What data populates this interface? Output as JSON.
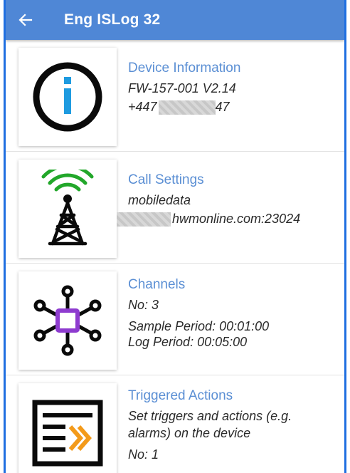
{
  "appbar": {
    "title": "Eng ISLog 32",
    "back_icon": "arrow-left-icon",
    "color": "#4f87d6"
  },
  "items": [
    {
      "title": "Device Information",
      "icon": "info-icon",
      "lines": [
        "FW-157-001 V2.14",
        "+447",
        "47"
      ]
    },
    {
      "title": "Call Settings",
      "icon": "antenna-tower-icon",
      "lines": [
        "mobiledata",
        "hwmonline.com:23024"
      ]
    },
    {
      "title": "Channels",
      "icon": "channels-hub-icon",
      "lines": [
        "No: 3",
        "Sample Period: 00:01:00",
        "Log Period: 00:05:00"
      ]
    },
    {
      "title": "Triggered Actions",
      "icon": "triggered-actions-icon",
      "lines": [
        "Set triggers and actions (e.g.",
        "alarms) on the device",
        "No: 1"
      ]
    }
  ],
  "colors": {
    "title_text": "#5b8fd4",
    "accent_blue": "#1e9be0",
    "accent_green": "#22a72a",
    "accent_purple": "#8e3bcf",
    "accent_orange": "#f39a1a"
  }
}
